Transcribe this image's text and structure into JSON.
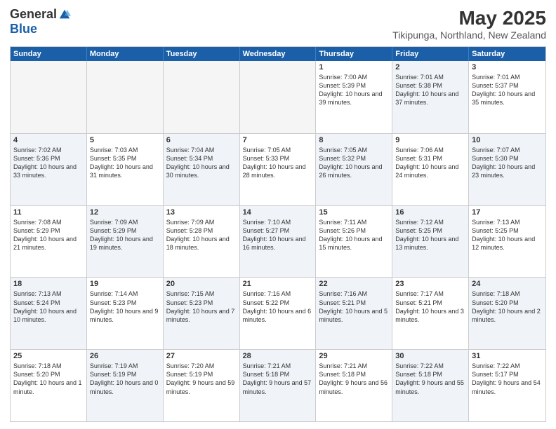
{
  "logo": {
    "general": "General",
    "blue": "Blue"
  },
  "title": {
    "month_year": "May 2025",
    "location": "Tikipunga, Northland, New Zealand"
  },
  "header_days": [
    "Sunday",
    "Monday",
    "Tuesday",
    "Wednesday",
    "Thursday",
    "Friday",
    "Saturday"
  ],
  "weeks": [
    [
      {
        "day": "",
        "sunrise": "",
        "sunset": "",
        "daylight": "",
        "empty": true
      },
      {
        "day": "",
        "sunrise": "",
        "sunset": "",
        "daylight": "",
        "empty": true
      },
      {
        "day": "",
        "sunrise": "",
        "sunset": "",
        "daylight": "",
        "empty": true
      },
      {
        "day": "",
        "sunrise": "",
        "sunset": "",
        "daylight": "",
        "empty": true
      },
      {
        "day": "1",
        "sunrise": "Sunrise: 7:00 AM",
        "sunset": "Sunset: 5:39 PM",
        "daylight": "Daylight: 10 hours and 39 minutes."
      },
      {
        "day": "2",
        "sunrise": "Sunrise: 7:01 AM",
        "sunset": "Sunset: 5:38 PM",
        "daylight": "Daylight: 10 hours and 37 minutes."
      },
      {
        "day": "3",
        "sunrise": "Sunrise: 7:01 AM",
        "sunset": "Sunset: 5:37 PM",
        "daylight": "Daylight: 10 hours and 35 minutes."
      }
    ],
    [
      {
        "day": "4",
        "sunrise": "Sunrise: 7:02 AM",
        "sunset": "Sunset: 5:36 PM",
        "daylight": "Daylight: 10 hours and 33 minutes."
      },
      {
        "day": "5",
        "sunrise": "Sunrise: 7:03 AM",
        "sunset": "Sunset: 5:35 PM",
        "daylight": "Daylight: 10 hours and 31 minutes."
      },
      {
        "day": "6",
        "sunrise": "Sunrise: 7:04 AM",
        "sunset": "Sunset: 5:34 PM",
        "daylight": "Daylight: 10 hours and 30 minutes."
      },
      {
        "day": "7",
        "sunrise": "Sunrise: 7:05 AM",
        "sunset": "Sunset: 5:33 PM",
        "daylight": "Daylight: 10 hours and 28 minutes."
      },
      {
        "day": "8",
        "sunrise": "Sunrise: 7:05 AM",
        "sunset": "Sunset: 5:32 PM",
        "daylight": "Daylight: 10 hours and 26 minutes."
      },
      {
        "day": "9",
        "sunrise": "Sunrise: 7:06 AM",
        "sunset": "Sunset: 5:31 PM",
        "daylight": "Daylight: 10 hours and 24 minutes."
      },
      {
        "day": "10",
        "sunrise": "Sunrise: 7:07 AM",
        "sunset": "Sunset: 5:30 PM",
        "daylight": "Daylight: 10 hours and 23 minutes."
      }
    ],
    [
      {
        "day": "11",
        "sunrise": "Sunrise: 7:08 AM",
        "sunset": "Sunset: 5:29 PM",
        "daylight": "Daylight: 10 hours and 21 minutes."
      },
      {
        "day": "12",
        "sunrise": "Sunrise: 7:09 AM",
        "sunset": "Sunset: 5:29 PM",
        "daylight": "Daylight: 10 hours and 19 minutes."
      },
      {
        "day": "13",
        "sunrise": "Sunrise: 7:09 AM",
        "sunset": "Sunset: 5:28 PM",
        "daylight": "Daylight: 10 hours and 18 minutes."
      },
      {
        "day": "14",
        "sunrise": "Sunrise: 7:10 AM",
        "sunset": "Sunset: 5:27 PM",
        "daylight": "Daylight: 10 hours and 16 minutes."
      },
      {
        "day": "15",
        "sunrise": "Sunrise: 7:11 AM",
        "sunset": "Sunset: 5:26 PM",
        "daylight": "Daylight: 10 hours and 15 minutes."
      },
      {
        "day": "16",
        "sunrise": "Sunrise: 7:12 AM",
        "sunset": "Sunset: 5:25 PM",
        "daylight": "Daylight: 10 hours and 13 minutes."
      },
      {
        "day": "17",
        "sunrise": "Sunrise: 7:13 AM",
        "sunset": "Sunset: 5:25 PM",
        "daylight": "Daylight: 10 hours and 12 minutes."
      }
    ],
    [
      {
        "day": "18",
        "sunrise": "Sunrise: 7:13 AM",
        "sunset": "Sunset: 5:24 PM",
        "daylight": "Daylight: 10 hours and 10 minutes."
      },
      {
        "day": "19",
        "sunrise": "Sunrise: 7:14 AM",
        "sunset": "Sunset: 5:23 PM",
        "daylight": "Daylight: 10 hours and 9 minutes."
      },
      {
        "day": "20",
        "sunrise": "Sunrise: 7:15 AM",
        "sunset": "Sunset: 5:23 PM",
        "daylight": "Daylight: 10 hours and 7 minutes."
      },
      {
        "day": "21",
        "sunrise": "Sunrise: 7:16 AM",
        "sunset": "Sunset: 5:22 PM",
        "daylight": "Daylight: 10 hours and 6 minutes."
      },
      {
        "day": "22",
        "sunrise": "Sunrise: 7:16 AM",
        "sunset": "Sunset: 5:21 PM",
        "daylight": "Daylight: 10 hours and 5 minutes."
      },
      {
        "day": "23",
        "sunrise": "Sunrise: 7:17 AM",
        "sunset": "Sunset: 5:21 PM",
        "daylight": "Daylight: 10 hours and 3 minutes."
      },
      {
        "day": "24",
        "sunrise": "Sunrise: 7:18 AM",
        "sunset": "Sunset: 5:20 PM",
        "daylight": "Daylight: 10 hours and 2 minutes."
      }
    ],
    [
      {
        "day": "25",
        "sunrise": "Sunrise: 7:18 AM",
        "sunset": "Sunset: 5:20 PM",
        "daylight": "Daylight: 10 hours and 1 minute."
      },
      {
        "day": "26",
        "sunrise": "Sunrise: 7:19 AM",
        "sunset": "Sunset: 5:19 PM",
        "daylight": "Daylight: 10 hours and 0 minutes."
      },
      {
        "day": "27",
        "sunrise": "Sunrise: 7:20 AM",
        "sunset": "Sunset: 5:19 PM",
        "daylight": "Daylight: 9 hours and 59 minutes."
      },
      {
        "day": "28",
        "sunrise": "Sunrise: 7:21 AM",
        "sunset": "Sunset: 5:18 PM",
        "daylight": "Daylight: 9 hours and 57 minutes."
      },
      {
        "day": "29",
        "sunrise": "Sunrise: 7:21 AM",
        "sunset": "Sunset: 5:18 PM",
        "daylight": "Daylight: 9 hours and 56 minutes."
      },
      {
        "day": "30",
        "sunrise": "Sunrise: 7:22 AM",
        "sunset": "Sunset: 5:18 PM",
        "daylight": "Daylight: 9 hours and 55 minutes."
      },
      {
        "day": "31",
        "sunrise": "Sunrise: 7:22 AM",
        "sunset": "Sunset: 5:17 PM",
        "daylight": "Daylight: 9 hours and 54 minutes."
      }
    ]
  ]
}
